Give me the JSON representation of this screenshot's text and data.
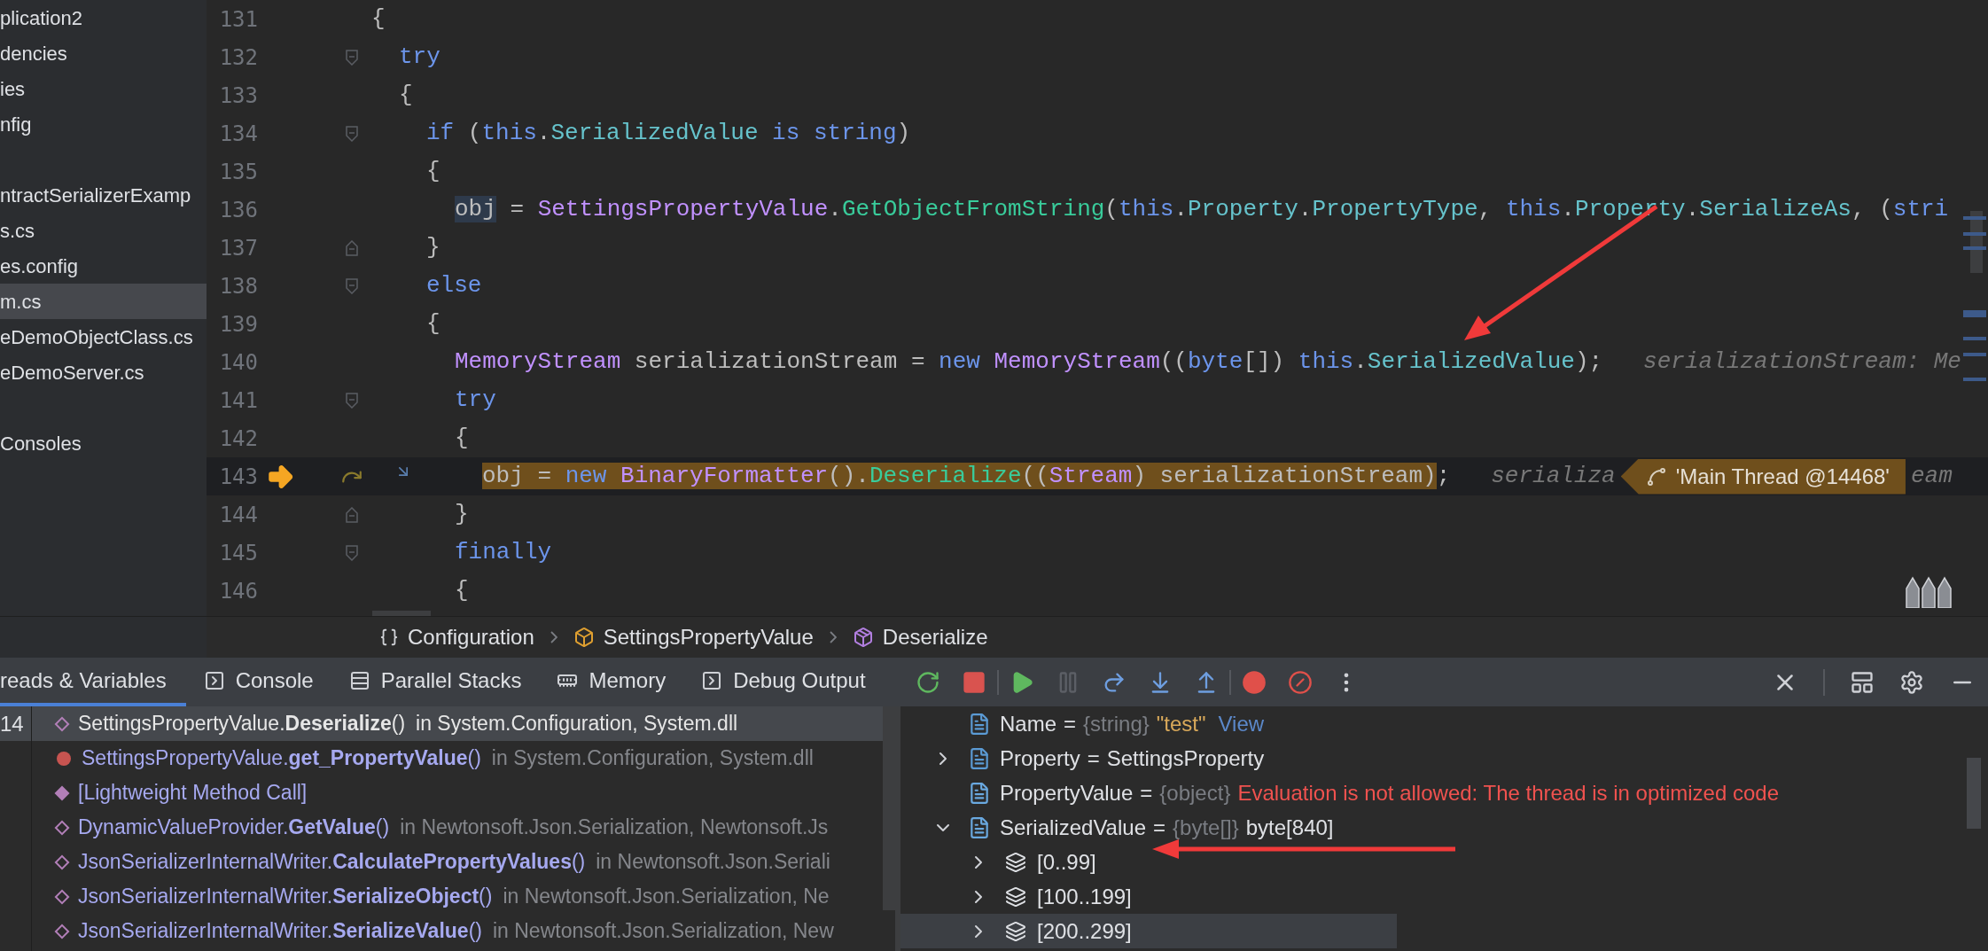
{
  "sidebar": {
    "groups": [
      {
        "items": [
          {
            "label": "plication2",
            "selected": false
          },
          {
            "label": "dencies",
            "selected": false
          },
          {
            "label": "ies",
            "selected": false
          },
          {
            "label": "nfig",
            "selected": false
          }
        ]
      },
      {
        "items": [
          {
            "label": "ntractSerializerExamp",
            "selected": false
          },
          {
            "label": "s.cs",
            "selected": false
          },
          {
            "label": "es.config",
            "selected": false
          },
          {
            "label": "m.cs",
            "selected": true
          },
          {
            "label": "eDemoObjectClass.cs",
            "selected": false
          },
          {
            "label": "eDemoServer.cs",
            "selected": false
          }
        ]
      },
      {
        "items": [
          {
            "label": "Consoles",
            "selected": false
          }
        ]
      }
    ]
  },
  "editor": {
    "lines": [
      {
        "number": "131",
        "current": false,
        "code": [
          {
            "kind": "plain",
            "text": "{"
          }
        ],
        "children": [
          {
            "number": "132",
            "kind": "fold_start",
            "current": false,
            "code": [
              {
                "kind": "kw",
                "text": "try"
              }
            ]
          },
          {
            "number": "133",
            "current": false,
            "code": [
              {
                "kind": "plain",
                "text": "{"
              }
            ],
            "children": [
              {
                "number": "134",
                "kind": "fold_start",
                "current": false,
                "code": [
                  {
                    "kind": "kw",
                    "text": "if"
                  },
                  {
                    "kind": "plain",
                    "text": " ("
                  },
                  {
                    "kind": "kw",
                    "text": "this"
                  },
                  {
                    "kind": "plain",
                    "text": "."
                  },
                  {
                    "kind": "field",
                    "text": "SerializedValue"
                  },
                  {
                    "kind": "kw",
                    "text": " is "
                  },
                  {
                    "kind": "kw",
                    "text": "string"
                  },
                  {
                    "kind": "plain",
                    "text": ")"
                  }
                ]
              },
              {
                "number": "135",
                "current": false,
                "code": [
                  {
                    "kind": "plain",
                    "text": "{"
                  }
                ],
                "children": [
                  {
                    "number": "136",
                    "current": false,
                    "code": [
                      {
                        "kind": "usage",
                        "text": "obj"
                      },
                      {
                        "kind": "plain",
                        "text": " = "
                      },
                      {
                        "kind": "type",
                        "text": "SettingsPropertyValue"
                      },
                      {
                        "kind": "plain",
                        "text": "."
                      },
                      {
                        "kind": "method",
                        "text": "GetObjectFromString"
                      },
                      {
                        "kind": "plain",
                        "text": "("
                      },
                      {
                        "kind": "kw",
                        "text": "this"
                      },
                      {
                        "kind": "plain",
                        "text": "."
                      },
                      {
                        "kind": "field",
                        "text": "Property"
                      },
                      {
                        "kind": "plain",
                        "text": "."
                      },
                      {
                        "kind": "field",
                        "text": "PropertyType"
                      },
                      {
                        "kind": "plain",
                        "text": ", "
                      },
                      {
                        "kind": "kw",
                        "text": "this"
                      },
                      {
                        "kind": "plain",
                        "text": "."
                      },
                      {
                        "kind": "field",
                        "text": "Property"
                      },
                      {
                        "kind": "plain",
                        "text": "."
                      },
                      {
                        "kind": "field",
                        "text": "SerializeAs"
                      },
                      {
                        "kind": "plain",
                        "text": ", ("
                      },
                      {
                        "kind": "kw",
                        "text": "stri"
                      }
                    ]
                  }
                ]
              },
              {
                "number": "137",
                "kind": "fold_end",
                "current": false,
                "code": [
                  {
                    "kind": "plain",
                    "text": "}"
                  }
                ]
              },
              {
                "number": "138",
                "kind": "fold_start",
                "current": false,
                "code": [
                  {
                    "kind": "kw",
                    "text": "else"
                  }
                ]
              },
              {
                "number": "139",
                "current": false,
                "code": [
                  {
                    "kind": "plain",
                    "text": "{"
                  }
                ],
                "children": [
                  {
                    "number": "140",
                    "current": false,
                    "code": [
                      {
                        "kind": "type",
                        "text": "MemoryStream"
                      },
                      {
                        "kind": "plain",
                        "text": " serializationStream = "
                      },
                      {
                        "kind": "kw",
                        "text": "new "
                      },
                      {
                        "kind": "type",
                        "text": "MemoryStream"
                      },
                      {
                        "kind": "plain",
                        "text": "(("
                      },
                      {
                        "kind": "kw",
                        "text": "byte"
                      },
                      {
                        "kind": "plain",
                        "text": "[]) "
                      },
                      {
                        "kind": "kw",
                        "text": "this"
                      },
                      {
                        "kind": "plain",
                        "text": "."
                      },
                      {
                        "kind": "field",
                        "text": "SerializedValue"
                      },
                      {
                        "kind": "plain",
                        "text": ");"
                      }
                    ],
                    "hints": [
                      {
                        "kind": "hint",
                        "text": "serializationStream: Me"
                      }
                    ]
                  },
                  {
                    "number": "141",
                    "kind": "fold_start",
                    "current": false,
                    "code": [
                      {
                        "kind": "kw",
                        "text": "try"
                      }
                    ]
                  },
                  {
                    "number": "142",
                    "current": false,
                    "code": [
                      {
                        "kind": "plain",
                        "text": "{"
                      }
                    ],
                    "children": [
                      {
                        "number": "143",
                        "current": true,
                        "code": [
                          {
                            "kind": "plain",
                            "text": "obj = ",
                            "highlighted": true
                          },
                          {
                            "kind": "kw",
                            "text": "new ",
                            "highlighted": true
                          },
                          {
                            "kind": "type",
                            "text": "BinaryFormatter",
                            "highlighted": true
                          },
                          {
                            "kind": "plain",
                            "text": "().",
                            "highlighted": true
                          },
                          {
                            "kind": "method",
                            "text": "Deserialize",
                            "highlighted": true
                          },
                          {
                            "kind": "plain",
                            "text": "((",
                            "highlighted": true
                          },
                          {
                            "kind": "type",
                            "text": "Stream",
                            "highlighted": true
                          },
                          {
                            "kind": "plain",
                            "text": ") serializationStream)",
                            "highlighted": true
                          },
                          {
                            "kind": "plain",
                            "text": ";",
                            "highlighted": false
                          }
                        ],
                        "hints": [
                          {
                            "kind": "hint",
                            "text": "serializa"
                          },
                          {
                            "kind": "thread",
                            "text": "'Main Thread @14468'"
                          },
                          {
                            "kind": "hint",
                            "text": "eam"
                          }
                        ]
                      }
                    ]
                  },
                  {
                    "number": "144",
                    "kind": "fold_end",
                    "current": false,
                    "code": [
                      {
                        "kind": "plain",
                        "text": "}"
                      }
                    ]
                  },
                  {
                    "number": "145",
                    "kind": "fold_start",
                    "current": false,
                    "code": [
                      {
                        "kind": "kw",
                        "text": "finally"
                      }
                    ]
                  },
                  {
                    "number": "146",
                    "current": false,
                    "code": [
                      {
                        "kind": "plain",
                        "text": "{"
                      }
                    ]
                  }
                ]
              }
            ]
          }
        ]
      }
    ]
  },
  "breadcrumbs": [
    {
      "kind": "namespace",
      "label": "Configuration"
    },
    {
      "kind": "class",
      "label": "SettingsPropertyValue"
    },
    {
      "kind": "method",
      "label": "Deserialize"
    }
  ],
  "tabs": [
    {
      "kind": "threads",
      "label": "reads & Variables",
      "selected": true
    },
    {
      "kind": "console",
      "label": "Console",
      "selected": false
    },
    {
      "kind": "stacks",
      "label": "Parallel Stacks",
      "selected": false
    },
    {
      "kind": "memory",
      "label": "Memory",
      "selected": false
    },
    {
      "kind": "output",
      "label": "Debug Output",
      "selected": false
    }
  ],
  "toolbar": [
    [
      {
        "kind": "rerun",
        "disabled": false
      },
      {
        "kind": "stop",
        "disabled": false
      }
    ],
    [
      {
        "kind": "resume",
        "disabled": false
      },
      {
        "kind": "pause",
        "disabled": true
      },
      {
        "kind": "step_over",
        "disabled": false
      },
      {
        "kind": "step_into",
        "disabled": false
      },
      {
        "kind": "step_out",
        "disabled": false
      }
    ],
    [
      {
        "kind": "breakpoints",
        "disabled": false
      },
      {
        "kind": "mute",
        "disabled": false
      },
      {
        "kind": "more",
        "disabled": false
      }
    ]
  ],
  "threads": [
    {
      "label": "14",
      "selected": true
    }
  ],
  "frames": [
    {
      "kind": "diamond",
      "selected": true,
      "name": "SettingsPropertyValue.**Deserialize**()",
      "location": "in System.Configuration, System.dll"
    },
    {
      "kind": "dot",
      "selected": false,
      "name": "SettingsPropertyValue.**get_PropertyValue**()",
      "location": "in System.Configuration, System.dll"
    },
    {
      "kind": "diamond_filled",
      "selected": false,
      "name": "[Lightweight Method Call]"
    },
    {
      "kind": "diamond",
      "selected": false,
      "name": "DynamicValueProvider.**GetValue**()",
      "location": "in Newtonsoft.Json.Serialization, Newtonsoft.Js"
    },
    {
      "kind": "diamond",
      "selected": false,
      "name": "JsonSerializerInternalWriter.**CalculatePropertyValues**()",
      "location": "in Newtonsoft.Json.Seriali"
    },
    {
      "kind": "diamond",
      "selected": false,
      "name": "JsonSerializerInternalWriter.**SerializeObject**()",
      "location": "in Newtonsoft.Json.Serialization, Ne"
    },
    {
      "kind": "diamond",
      "selected": false,
      "name": "JsonSerializerInternalWriter.**SerializeValue**()",
      "location": "in Newtonsoft.Json.Serialization, New"
    }
  ],
  "variables": [
    {
      "kind": "field",
      "name": "Name",
      "operator": "=",
      "type": "{string}",
      "value": {
        "kind": "string",
        "text": "\"test\""
      },
      "link": "View"
    },
    {
      "kind": "field",
      "name": "Property",
      "expanded": false,
      "operator": "=",
      "value": {
        "kind": "plain",
        "text": "SettingsProperty"
      }
    },
    {
      "kind": "property",
      "name": "PropertyValue",
      "operator": "=",
      "type": "{object}",
      "value": {
        "kind": "error",
        "text": "Evaluation is not allowed: The thread is in optimized code"
      }
    },
    {
      "kind": "property",
      "name": "SerializedValue",
      "expanded": true,
      "operator": "=",
      "type": "{byte[]}",
      "value": {
        "kind": "plain",
        "text": "byte[840]"
      },
      "children": [
        {
          "label": "[0..99]",
          "selected": false
        },
        {
          "label": "[100..199]",
          "selected": false
        },
        {
          "label": "[200..299]",
          "selected": true
        }
      ]
    }
  ]
}
